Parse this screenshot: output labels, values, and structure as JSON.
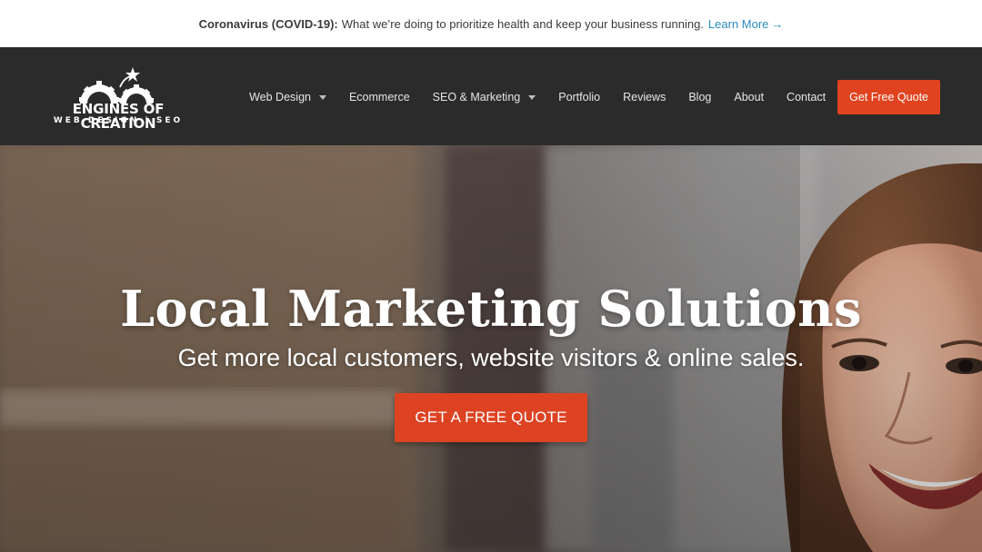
{
  "announcement": {
    "label": "Coronavirus (COVID-19):",
    "message": "What we’re doing to prioritize health and keep your business running.",
    "link_text": "Learn More",
    "arrow": "→"
  },
  "logo": {
    "name": "ENGINES OF CREATION",
    "tagline": "WEB DESIGN | SEO",
    "icons": [
      "gear-icon",
      "star-icon"
    ]
  },
  "nav": {
    "items": [
      {
        "label": "Web Design",
        "dropdown": true
      },
      {
        "label": "Ecommerce",
        "dropdown": false
      },
      {
        "label": "SEO & Marketing",
        "dropdown": true
      },
      {
        "label": "Portfolio",
        "dropdown": false
      },
      {
        "label": "Reviews",
        "dropdown": false
      },
      {
        "label": "Blog",
        "dropdown": false
      },
      {
        "label": "About",
        "dropdown": false
      },
      {
        "label": "Contact",
        "dropdown": false
      }
    ],
    "cta_label": "Get Free Quote"
  },
  "hero": {
    "title": "Local Marketing Solutions",
    "subtitle": "Get more local customers, website visitors & online sales.",
    "cta_label": "GET A FREE QUOTE"
  },
  "colors": {
    "accent": "#e0431f",
    "header_bg": "#2b2b2b",
    "link": "#2a8bbf"
  }
}
